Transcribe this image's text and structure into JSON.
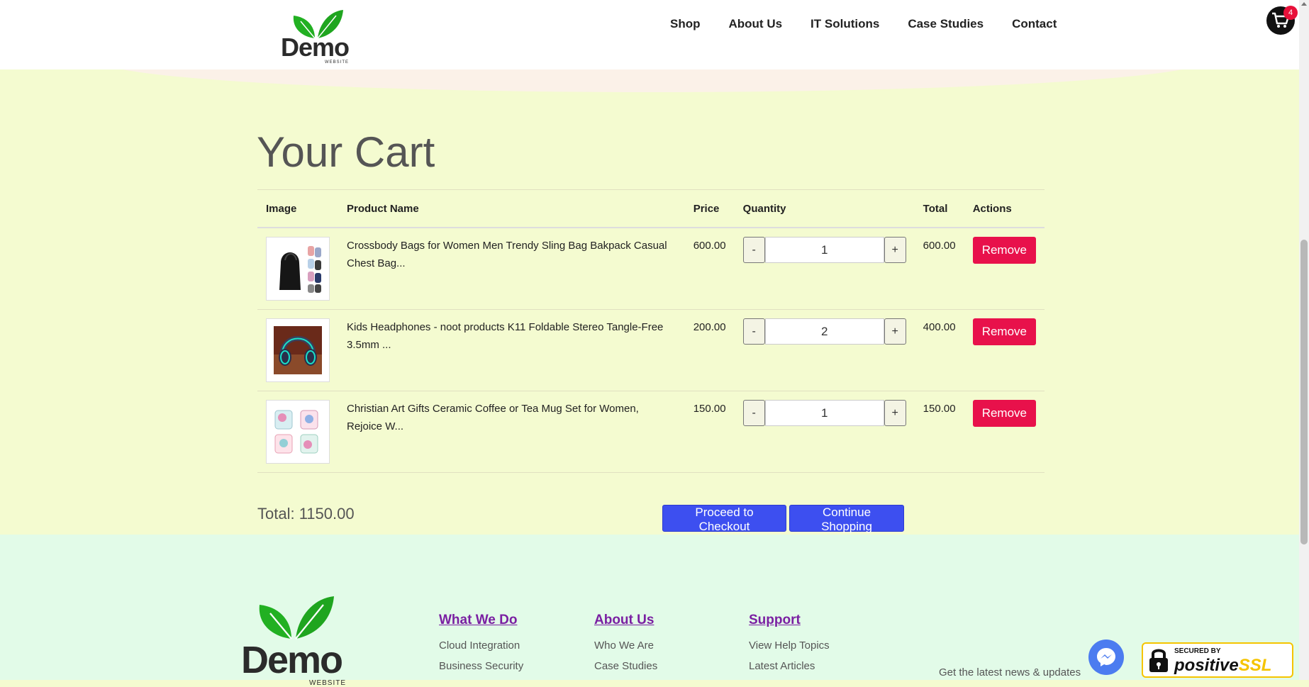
{
  "header": {
    "logo": {
      "word": "Demo",
      "sub": "WEBSITE"
    },
    "nav": [
      "Shop",
      "About Us",
      "IT Solutions",
      "Case Studies",
      "Contact"
    ],
    "cart_count": "4"
  },
  "cart": {
    "title": "Your Cart",
    "columns": [
      "Image",
      "Product Name",
      "Price",
      "Quantity",
      "Total",
      "Actions"
    ],
    "rows": [
      {
        "name": "Crossbody Bags for Women Men Trendy Sling Bag Bakpack Casual Chest Bag...",
        "price": "600.00",
        "qty": "1",
        "total": "600.00",
        "remove": "Remove"
      },
      {
        "name": "Kids Headphones - noot products K11 Foldable Stereo Tangle-Free 3.5mm ...",
        "price": "200.00",
        "qty": "2",
        "total": "400.00",
        "remove": "Remove"
      },
      {
        "name": "Christian Art Gifts Ceramic Coffee or Tea Mug Set for Women, Rejoice W...",
        "price": "150.00",
        "qty": "1",
        "total": "150.00",
        "remove": "Remove"
      }
    ],
    "qty_minus": "-",
    "qty_plus": "+",
    "total_text": "Total: 1150.00",
    "checkout_label": "Proceed to Checkout",
    "continue_label": "Continue Shopping"
  },
  "footer": {
    "logo": {
      "word": "Demo",
      "sub": "WEBSITE"
    },
    "columns": [
      {
        "title": "What We Do",
        "links": [
          "Cloud Integration",
          "Business Security"
        ]
      },
      {
        "title": "About Us",
        "links": [
          "Who We Are",
          "Case Studies"
        ]
      },
      {
        "title": "Support",
        "links": [
          "View Help Topics",
          "Latest Articles"
        ]
      }
    ],
    "newsletter": "Get the latest news & updates",
    "ssl": {
      "secured": "SECURED BY",
      "brand_a": "positive",
      "brand_b": "SSL"
    }
  },
  "colors": {
    "accent_blue": "#3d4ff0",
    "remove_red": "#e8114b",
    "leaf_green": "#2ab52a",
    "footer_heading": "#7a1fa2"
  }
}
